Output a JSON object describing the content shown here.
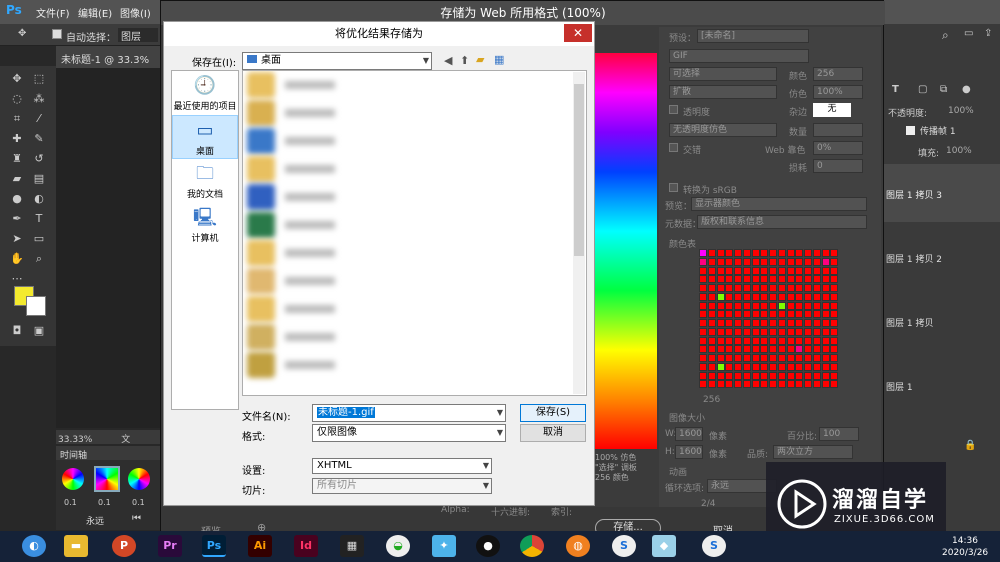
{
  "ps": {
    "menu": [
      "文件(F)",
      "编辑(E)",
      "图像(I)"
    ],
    "auto_select": "自动选择：",
    "auto_select_value": "图层",
    "doc_tab": "未标题-1 @ 33.3% (图",
    "zoom": "33.33%",
    "doc_label": "文档:7.32",
    "timeline_title": "时间轴",
    "frame_delay": "0.1",
    "loop_value": "永远"
  },
  "sfw": {
    "title": "存储为 Web 所用格式 (100%)",
    "preset_label": "预设：",
    "preset_value": "[未命名]",
    "format": "GIF",
    "reduction": "可选择",
    "dither_algo": "扩散",
    "transparency": "透明度",
    "matte_label": "杂边",
    "matte_value": "无",
    "no_dither": "无透明度仿色",
    "interlaced": "交错",
    "colors_label": "颜色",
    "colors_value": "256",
    "dither_label": "仿色",
    "dither_value": "100%",
    "amount_label": "数量",
    "web_snap_label": "Web 靠色",
    "web_snap_value": "0%",
    "lossy_label": "损耗",
    "lossy_value": "0",
    "convert_srgb": "转换为 sRGB",
    "preview_label": "预览：",
    "preview_value": "显示器颜色",
    "metadata_label": "元数据：",
    "metadata_value": "版权和联系信息",
    "color_table_title": "颜色表",
    "color_count": "256",
    "image_size_title": "图像大小",
    "w_label": "W:",
    "w_value": "1600",
    "h_label": "H:",
    "h_value": "1600",
    "px": "像素",
    "percent_label": "百分比:",
    "percent_value": "100",
    "quality_label": "品质:",
    "quality_value": "两次立方",
    "anim_title": "动画",
    "loop_label": "循环选项:",
    "loop_value": "永远",
    "frame_index": "2/4",
    "preview_btn": "预览",
    "save_btn": "存储...",
    "cancel_btn": "取消",
    "alpha_label": "Alpha:",
    "hex_label": "十六进制:",
    "index_label": "索引:",
    "left_strip": [
      "100% 仿色",
      "\"选择\" 调板",
      "256 颜色"
    ]
  },
  "ps_right": {
    "opacity_label": "不透明度:",
    "opacity_value": "100%",
    "fill_label": "填充:",
    "fill_value": "100%",
    "propagate_label": "传播帧 1",
    "layers": [
      "图层 1 拷贝 3",
      "图层 1 拷贝 2",
      "图层 1 拷贝",
      "图层 1"
    ]
  },
  "save_dialog": {
    "title": "将优化结果存储为",
    "save_in_label": "保存在(I):",
    "save_in_value": "桌面",
    "places": [
      {
        "label": "最近使用的项目",
        "icon": "recent-icon"
      },
      {
        "label": "桌面",
        "icon": "desktop-icon"
      },
      {
        "label": "我的文档",
        "icon": "documents-icon"
      },
      {
        "label": "计算机",
        "icon": "computer-icon"
      }
    ],
    "filename_label": "文件名(N):",
    "filename_value": "未标题-1.gif",
    "format_label": "格式:",
    "format_value": "仅限图像",
    "settings_label": "设置:",
    "settings_value": "XHTML",
    "slices_label": "切片:",
    "slices_value": "所有切片",
    "save_button": "保存(S)",
    "cancel_button": "取消"
  },
  "taskbar": {
    "time": "14:36",
    "date": "2020/3/26"
  },
  "watermark": {
    "brand": "溜溜自学",
    "url": "ZIXUE.3D66.COM"
  },
  "colors": {
    "accent": "#0078d7",
    "close": "#c6302b",
    "arrow": "#d9221c"
  }
}
